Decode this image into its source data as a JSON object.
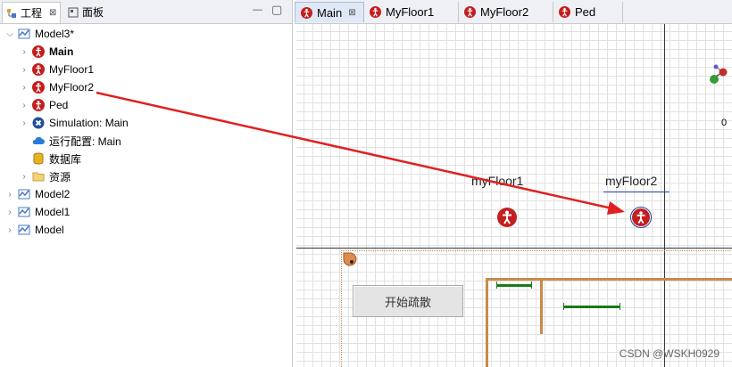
{
  "left_tabs": [
    {
      "label": "工程",
      "close": "⊠"
    },
    {
      "label": "面板"
    }
  ],
  "left_tab_controls": {
    "minimize": "—",
    "maximize": "▢"
  },
  "tree": [
    {
      "label": "Model3*",
      "icon": "model-icon",
      "expanded": true,
      "level": 0,
      "bold": false
    },
    {
      "label": "Main",
      "icon": "pedestrian-icon",
      "level": 1,
      "bold": true
    },
    {
      "label": "MyFloor1",
      "icon": "pedestrian-icon",
      "level": 1,
      "bold": false
    },
    {
      "label": "MyFloor2",
      "icon": "pedestrian-icon",
      "level": 1,
      "bold": false
    },
    {
      "label": "Ped",
      "icon": "pedestrian-icon",
      "level": 1,
      "bold": false
    },
    {
      "label": "Simulation: Main",
      "icon": "simulation-icon",
      "level": 1,
      "bold": false
    },
    {
      "label": "运行配置: Main",
      "icon": "cloud-icon",
      "level": 1,
      "bold": false
    },
    {
      "label": "数据库",
      "icon": "database-icon",
      "level": 1,
      "bold": false
    },
    {
      "label": "资源",
      "icon": "folder-icon",
      "level": 1,
      "bold": false
    },
    {
      "label": "Model2",
      "icon": "model-icon",
      "level": 0,
      "bold": false
    },
    {
      "label": "Model1",
      "icon": "model-icon",
      "level": 0,
      "bold": false
    },
    {
      "label": "Model",
      "icon": "model-icon",
      "level": 0,
      "bold": false
    }
  ],
  "editor_tabs": [
    {
      "label": "Main",
      "active": true,
      "close": "⊠"
    },
    {
      "label": "MyFloor1",
      "active": false
    },
    {
      "label": "MyFloor2",
      "active": false
    },
    {
      "label": "Ped",
      "active": false
    }
  ],
  "canvas": {
    "floor1_label": "myFloor1",
    "floor2_label": "myFloor2",
    "axis_label": "0",
    "start_button": "开始疏散"
  },
  "watermark": "CSDN @WSKH0929",
  "colors": {
    "accent_red": "#e02020",
    "pedestrian": "#c41e1e",
    "wall": "#c98a4a",
    "green_line": "#1a7a1a"
  }
}
